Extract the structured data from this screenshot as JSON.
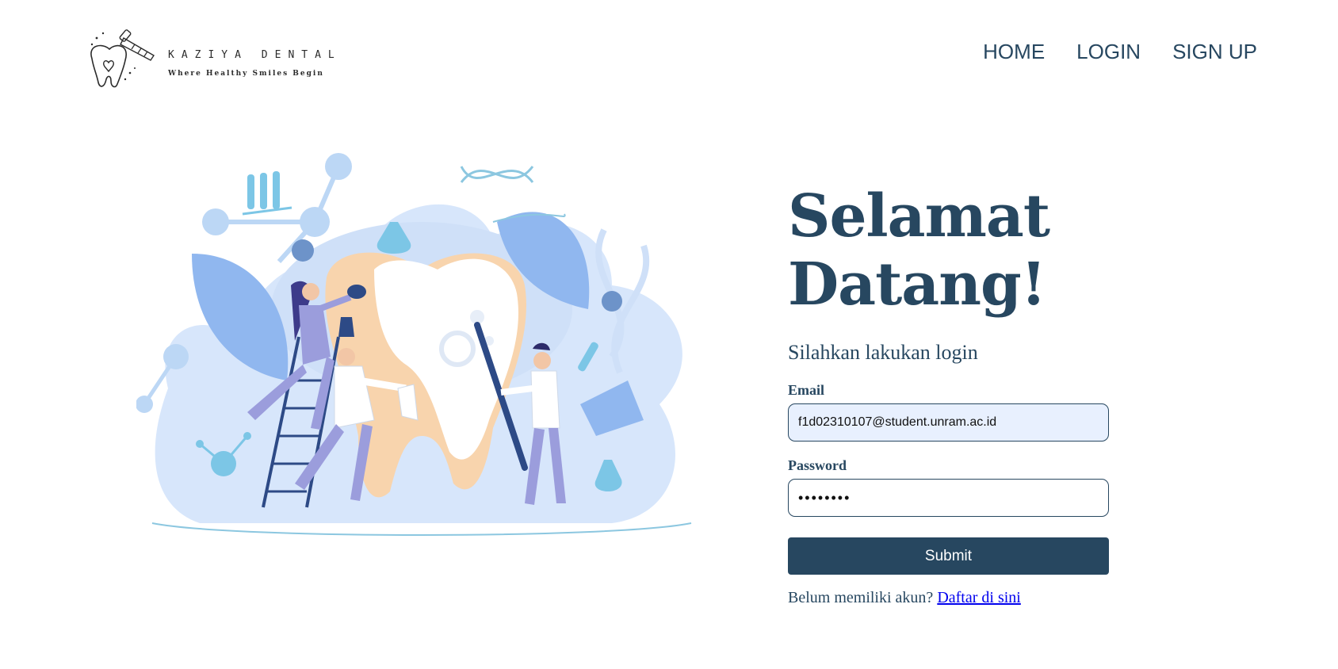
{
  "brand": {
    "name": "KAZIYA DENTAL",
    "tagline": "Where Healthy Smiles Begin"
  },
  "nav": {
    "items": [
      {
        "label": "HOME"
      },
      {
        "label": "LOGIN"
      },
      {
        "label": "SIGN UP"
      }
    ]
  },
  "login": {
    "title_line1": "Selamat",
    "title_line2": "Datang!",
    "subtitle": "Silahkan lakukan login",
    "email_label": "Email",
    "email_value": "f1d02310107@student.unram.ac.id",
    "password_label": "Password",
    "password_value": "••••••••",
    "submit_label": "Submit",
    "signup_prompt": "Belum memiliki akun?",
    "signup_link": "Daftar di sini"
  },
  "colors": {
    "primary": "#274760",
    "autofill_bg": "#e8f0fe",
    "link": "#0000ee"
  },
  "icons": [
    "tooth-logo-icon",
    "dental-team-illustration"
  ]
}
